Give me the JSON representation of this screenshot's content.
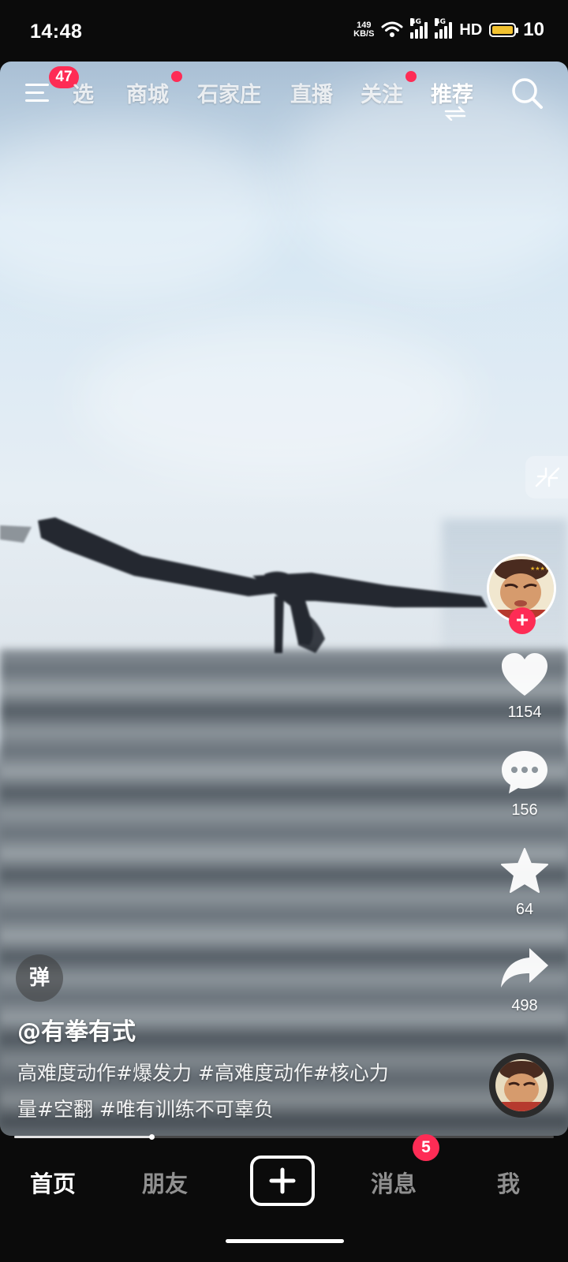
{
  "status_bar": {
    "time": "14:48",
    "net_speed_value": "149",
    "net_speed_unit": "KB/S",
    "sim1_tag": "4G",
    "sim2_tag": "4G",
    "hd_label": "HD",
    "battery_level": "10"
  },
  "top_nav": {
    "menu_badge": "47",
    "tabs": [
      {
        "label": "选"
      },
      {
        "label": "商城",
        "has_dot": true
      },
      {
        "label": "石家庄"
      },
      {
        "label": "直播"
      },
      {
        "label": "关注",
        "has_dot": true
      },
      {
        "label": "推荐",
        "active": true
      }
    ]
  },
  "actions": {
    "likes": "1154",
    "comments": "156",
    "favorites": "64",
    "shares": "498"
  },
  "video": {
    "danmu_label": "弹",
    "author": "@有拳有式",
    "description_line1": "高难度动作#爆发力 #高难度动作#核心力",
    "description_line2": "量#空翻 #唯有训练不可辜负",
    "progress_fraction": 0.255
  },
  "bottom_nav": {
    "home": "首页",
    "friends": "朋友",
    "messages": "消息",
    "messages_badge": "5",
    "me": "我"
  },
  "colors": {
    "accent": "#fe2c55",
    "battery": "#f2c230"
  },
  "icons": [
    "menu-icon",
    "search-icon",
    "swap-icon",
    "collapse-icon",
    "heart-icon",
    "comment-icon",
    "star-icon",
    "share-icon",
    "plus-icon",
    "wifi-icon",
    "signal-icon",
    "battery-icon"
  ]
}
